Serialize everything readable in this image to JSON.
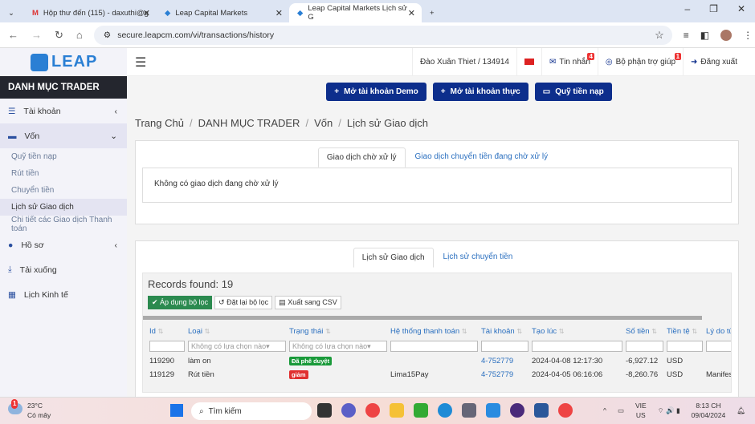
{
  "browser": {
    "tabs": [
      {
        "label": "Hộp thư đến (115) - daxuthi@g"
      },
      {
        "label": "Leap Capital Markets"
      },
      {
        "label": "Leap Capital Markets Lịch sử G"
      }
    ],
    "url": "secure.leapcm.com/vi/transactions/history"
  },
  "logo": "LEAP",
  "topbar": {
    "user": "Đào Xuân Thiet / 134914",
    "messages": "Tin nhắn",
    "messages_badge": "4",
    "support": "Bộ phận trợ giúp",
    "support_badge": "1",
    "logout": "Đăng xuất"
  },
  "sidebar": {
    "title": "DANH MỤC TRADER",
    "items": [
      {
        "label": "Tài khoản"
      },
      {
        "label": "Vốn"
      },
      {
        "label": "Hồ sơ"
      },
      {
        "label": "Tải xuống"
      },
      {
        "label": "Lịch Kinh tế"
      }
    ],
    "sub": [
      {
        "label": "Quỹ tiền nạp"
      },
      {
        "label": "Rút tiền"
      },
      {
        "label": "Chuyển tiền"
      },
      {
        "label": "Lịch sử Giao dịch"
      },
      {
        "label": "Chi tiết các Giao dịch Thanh toán"
      }
    ]
  },
  "actions": {
    "demo": "Mở tài khoản Demo",
    "real": "Mở tài khoản thực",
    "fund": "Quỹ tiền nạp"
  },
  "breadcrumb": [
    "Trang Chủ",
    "DANH MỤC TRADER",
    "Vốn",
    "Lịch sử Giao dịch"
  ],
  "pending": {
    "tabs": [
      "Giao dịch chờ xử lý",
      "Giao dịch chuyển tiền đang chờ xử lý"
    ],
    "empty": "Không có giao dịch đang chờ xử lý"
  },
  "history": {
    "tabs": [
      "Lịch sử Giao dịch",
      "Lịch sử chuyển tiền"
    ],
    "records": "Records found: 19",
    "apply": "Áp dụng bộ lọc",
    "reset": "Đặt lại bộ lọc",
    "export": "Xuất sang CSV",
    "columns": [
      "Id",
      "Loại",
      "Trạng thái",
      "Hệ thống thanh toán",
      "Tài khoản",
      "Tạo lúc",
      "Số tiền",
      "Tiền tệ",
      "Lý do từ c"
    ],
    "filter_placeholder": "Không có lựa chọn nào",
    "rows": [
      {
        "id": "119290",
        "type": "làm on",
        "status": "Đã phê duyệt",
        "status_color": "#1a9a3a",
        "system": "",
        "account": "4-752779",
        "created": "2024-04-08 12:17:30",
        "amount": "-6,927.12",
        "currency": "USD",
        "reason": ""
      },
      {
        "id": "119129",
        "type": "Rút tiền",
        "status": "giảm",
        "status_color": "#e03030",
        "system": "Lima15Pay",
        "account": "4-752779",
        "created": "2024-04-05 06:16:06",
        "amount": "-8,260.76",
        "currency": "USD",
        "reason": "Manifest E"
      }
    ]
  },
  "taskbar": {
    "temp": "23°C",
    "weather": "Có mây",
    "weather_badge": "1",
    "search": "Tìm kiếm",
    "lang1": "VIE",
    "lang2": "US",
    "time": "8:13 CH",
    "date": "09/04/2024"
  }
}
